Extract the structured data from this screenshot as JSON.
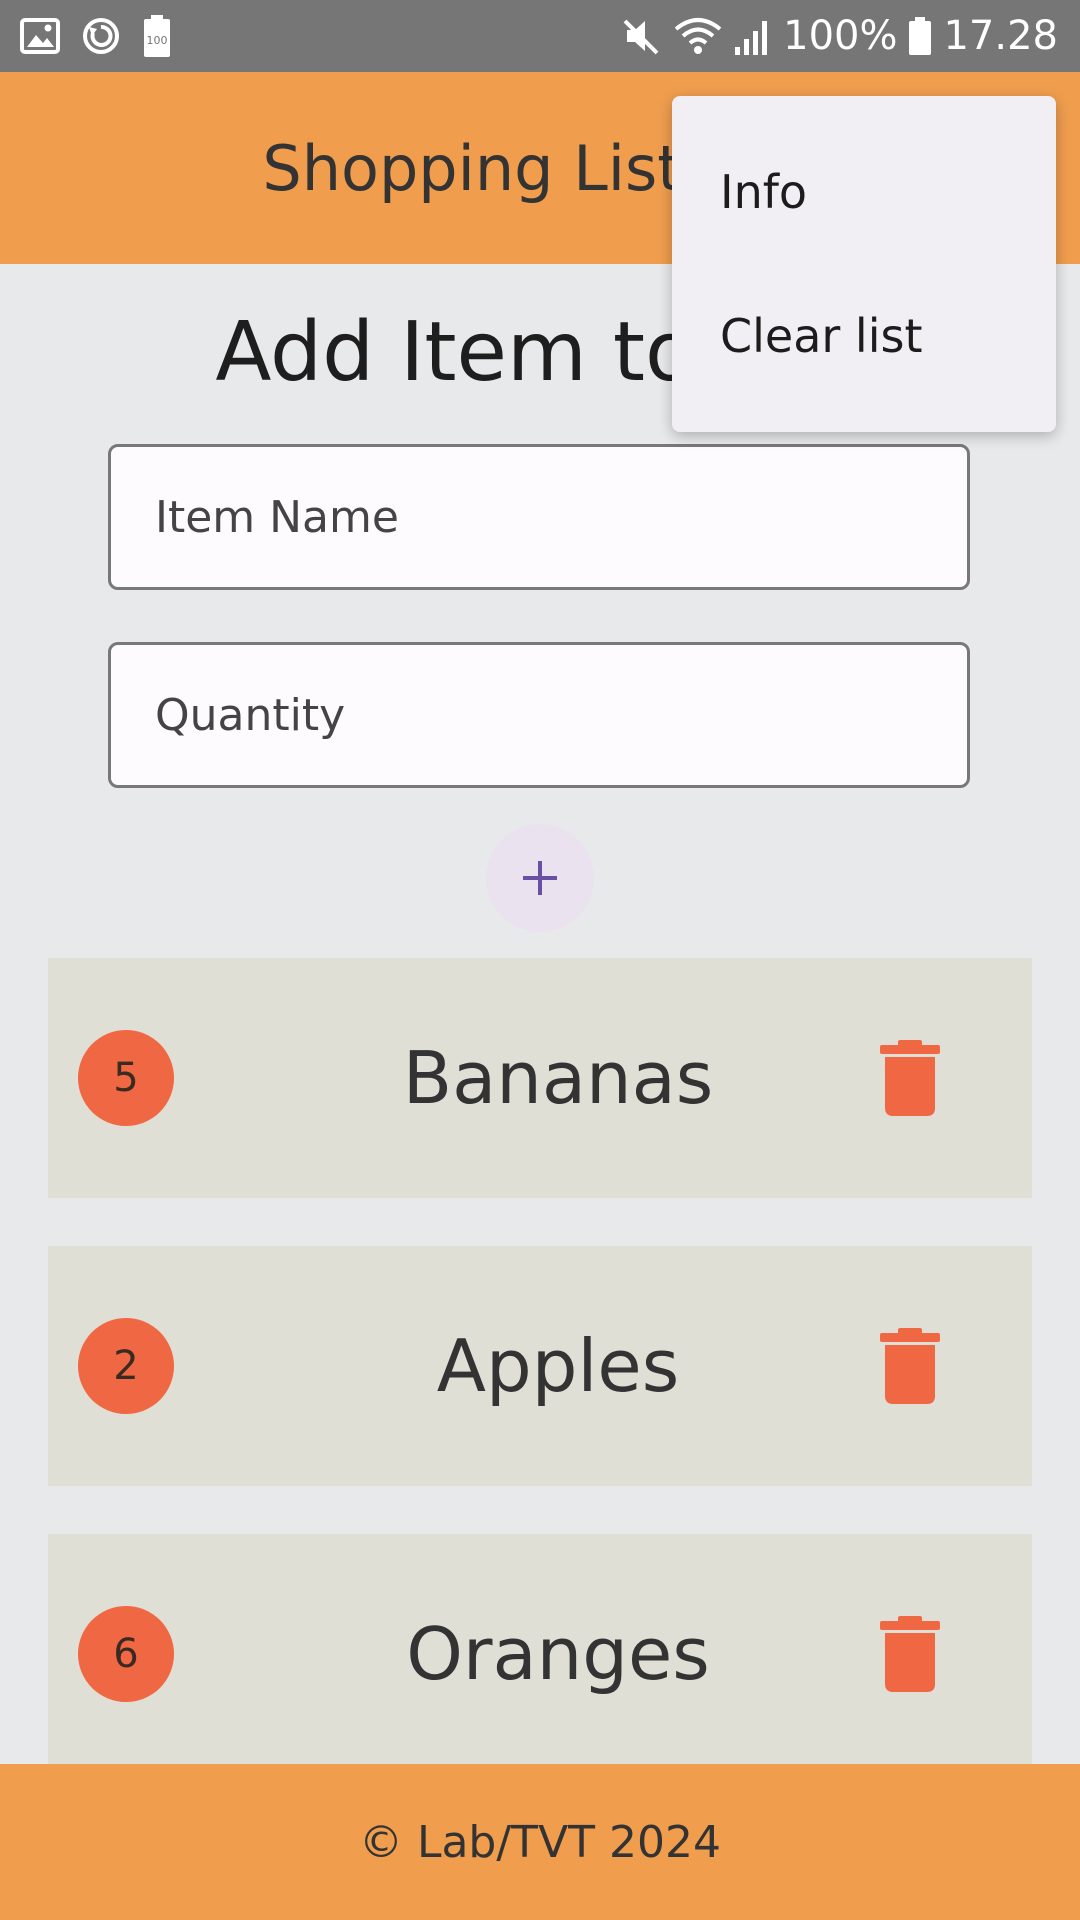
{
  "status_bar": {
    "battery_percent": "100%",
    "time": "17.28",
    "icons": [
      "image-icon",
      "sync-icon",
      "battery-saver-icon",
      "mute-icon",
      "wifi-icon",
      "signal-icon",
      "battery-icon"
    ]
  },
  "app_bar": {
    "title": "Shopping List"
  },
  "form": {
    "heading": "Add Item to List",
    "item_name_placeholder": "Item Name",
    "quantity_placeholder": "Quantity",
    "add_icon": "plus-icon"
  },
  "items": [
    {
      "quantity": "5",
      "name": "Bananas"
    },
    {
      "quantity": "2",
      "name": "Apples"
    },
    {
      "quantity": "6",
      "name": "Oranges"
    }
  ],
  "footer": {
    "text": "© Lab/TVT 2024"
  },
  "overflow_menu": {
    "items": [
      {
        "label": "Info"
      },
      {
        "label": "Clear list"
      }
    ]
  },
  "colors": {
    "app_bar": "#f09d4e",
    "accent_red": "#f06843",
    "item_bg": "#dfdfd6",
    "status_bar": "#767676"
  }
}
